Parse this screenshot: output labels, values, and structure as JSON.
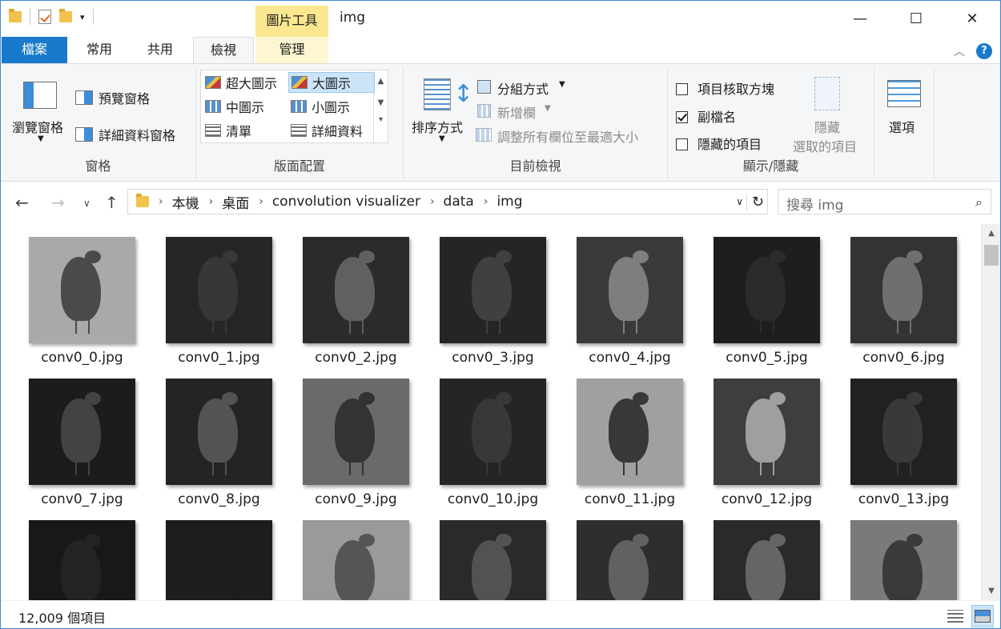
{
  "window": {
    "title": "img",
    "tool_tab": "圖片工具",
    "minimize": "—",
    "maximize": "☐",
    "close": "✕"
  },
  "tabs": [
    {
      "label": "檔案"
    },
    {
      "label": "常用"
    },
    {
      "label": "共用"
    },
    {
      "label": "檢視"
    },
    {
      "label": "管理"
    }
  ],
  "ribbon": {
    "panes": {
      "label": "窗格",
      "nav_pane": "瀏覽窗格",
      "preview_pane": "預覽窗格",
      "details_pane": "詳細資料窗格"
    },
    "layout": {
      "label": "版面配置",
      "items": [
        "超大圖示",
        "大圖示",
        "中圖示",
        "小圖示",
        "清單",
        "詳細資料"
      ],
      "selected": "大圖示"
    },
    "current_view": {
      "label": "目前檢視",
      "sort_by": "排序方式",
      "group_by": "分組方式",
      "add_columns": "新增欄",
      "size_all": "調整所有欄位至最適大小"
    },
    "show_hide": {
      "label": "顯示/隱藏",
      "item_checkboxes": "項目核取方塊",
      "file_extensions": "副檔名",
      "hidden_items": "隱藏的項目",
      "hide_selected_1": "隱藏",
      "hide_selected_2": "選取的項目",
      "item_checkboxes_checked": false,
      "file_extensions_checked": true,
      "hidden_items_checked": false
    },
    "options": {
      "label": "選項"
    }
  },
  "address": {
    "crumbs": [
      "本機",
      "桌面",
      "convolution visualizer",
      "data",
      "img"
    ],
    "search_placeholder": "搜尋 img"
  },
  "files": [
    {
      "name": "conv0_0.jpg",
      "bg": "#a9a9a9",
      "fg": "#3a3a3a"
    },
    {
      "name": "conv0_1.jpg",
      "bg": "#262626",
      "fg": "#3a3a3a"
    },
    {
      "name": "conv0_2.jpg",
      "bg": "#2b2b2b",
      "fg": "#6a6a6a"
    },
    {
      "name": "conv0_3.jpg",
      "bg": "#252525",
      "fg": "#454545"
    },
    {
      "name": "conv0_4.jpg",
      "bg": "#3a3a3a",
      "fg": "#8a8a8a"
    },
    {
      "name": "conv0_5.jpg",
      "bg": "#1e1e1e",
      "fg": "#2e2e2e"
    },
    {
      "name": "conv0_6.jpg",
      "bg": "#333333",
      "fg": "#7a7a7a"
    },
    {
      "name": "conv0_7.jpg",
      "bg": "#1c1c1c",
      "fg": "#4a4a4a"
    },
    {
      "name": "conv0_8.jpg",
      "bg": "#242424",
      "fg": "#5c5c5c"
    },
    {
      "name": "conv0_9.jpg",
      "bg": "#6a6a6a",
      "fg": "#2a2a2a"
    },
    {
      "name": "conv0_10.jpg",
      "bg": "#252525",
      "fg": "#3c3c3c"
    },
    {
      "name": "conv0_11.jpg",
      "bg": "#a0a0a0",
      "fg": "#262626"
    },
    {
      "name": "conv0_12.jpg",
      "bg": "#3e3e3e",
      "fg": "#b0b0b0"
    },
    {
      "name": "conv0_13.jpg",
      "bg": "#212121",
      "fg": "#3e3e3e"
    },
    {
      "name": "",
      "bg": "#181818",
      "fg": "#262626"
    },
    {
      "name": "",
      "bg": "#1d1d1d",
      "fg": "#1d1d1d"
    },
    {
      "name": "",
      "bg": "#9a9a9a",
      "fg": "#4a4a4a"
    },
    {
      "name": "",
      "bg": "#2a2a2a",
      "fg": "#5a5a5a"
    },
    {
      "name": "",
      "bg": "#2e2e2e",
      "fg": "#6a6a6a"
    },
    {
      "name": "",
      "bg": "#2a2a2a",
      "fg": "#707070"
    },
    {
      "name": "",
      "bg": "#7a7a7a",
      "fg": "#303030"
    }
  ],
  "status": {
    "count": "12,009 個項目"
  }
}
